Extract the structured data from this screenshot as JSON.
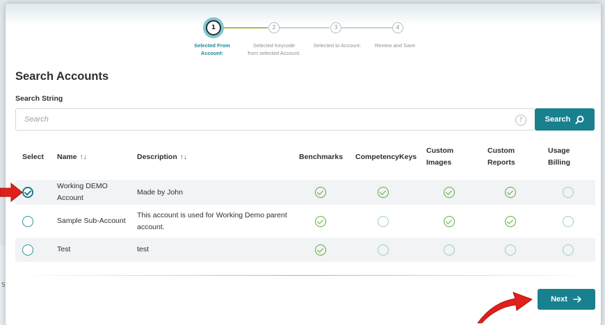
{
  "stepper": {
    "steps": [
      {
        "number": "1",
        "label": "Selected From Account:",
        "state": "active"
      },
      {
        "number": "2",
        "label": "Selected Keycode from selected Account:",
        "state": "pending"
      },
      {
        "number": "3",
        "label": "Selected to Account:",
        "state": "pending"
      },
      {
        "number": "4",
        "label": "Review and Save",
        "state": "pending"
      }
    ]
  },
  "page": {
    "title": "Search Accounts",
    "search_label": "Search String",
    "search_placeholder": "Search",
    "help_icon_text": "?",
    "search_button_label": "Search",
    "next_button_label": "Next"
  },
  "table": {
    "columns": {
      "select": "Select",
      "name": "Name",
      "description": "Description",
      "benchmarks": "Benchmarks",
      "competency_keys": "CompetencyKeys",
      "custom_images": "Custom Images",
      "custom_reports": "Custom Reports",
      "usage_billing": "Usage Billing"
    },
    "sort_glyph": "↑↓",
    "rows": [
      {
        "selected": true,
        "name": "Working DEMO Account",
        "description": "Made by John",
        "benchmarks": true,
        "competency_keys": true,
        "custom_images": true,
        "custom_reports": true,
        "usage_billing": false
      },
      {
        "selected": false,
        "name": "Sample Sub-Account",
        "description": "This account is used for Working Demo parent account.",
        "benchmarks": true,
        "competency_keys": false,
        "custom_images": true,
        "custom_reports": true,
        "usage_billing": false
      },
      {
        "selected": false,
        "name": "Test",
        "description": "test",
        "benchmarks": true,
        "competency_keys": false,
        "custom_images": false,
        "custom_reports": false,
        "usage_billing": false
      }
    ]
  },
  "background": {
    "left_edge_letter": "S"
  },
  "colors": {
    "accent": "#19808e",
    "check_green": "#5faa3a",
    "step_active_ring": "#7fc7d3",
    "annotation_arrow": "#e0201b"
  }
}
